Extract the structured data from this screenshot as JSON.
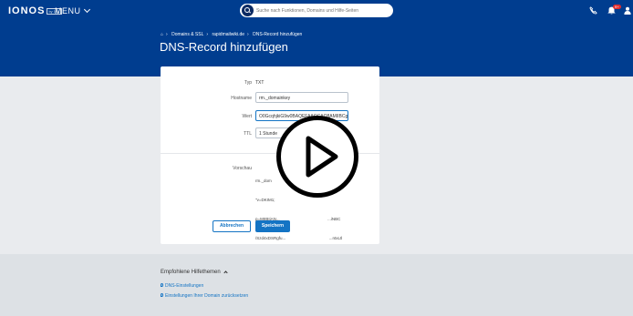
{
  "header": {
    "logo": "IONOS",
    "logo_sub": "by 1&1",
    "menu_label": "MENU",
    "search_placeholder": "Suche nach Funktionen, Domains und Hilfe-Seiten",
    "notification_count": "9+"
  },
  "breadcrumb": {
    "items": [
      "Domains & SSL",
      "rapidmailwiki.de",
      "DNS-Record hinzufügen"
    ]
  },
  "page": {
    "title": "DNS-Record hinzufügen"
  },
  "form": {
    "typ_label": "Typ",
    "typ_value": "TXT",
    "hostname_label": "Hostname",
    "hostname_value": "rm._domainkey",
    "wert_label": "Wert",
    "wert_value": "O0GcqhjkiG9w0BAQEFAAOCAQ8AMIIBCgKCAQEAxDAQAB",
    "ttl_label": "TTL",
    "ttl_value": "1 Stunde",
    "vorschau_label": "Vorschau",
    "vorschau_lines": [
      "rm._dom",
      "\"v=DKIM1;",
      "p=MIIBIjAN...                                          ...iNBC",
      "/Szd4xDSRgfu...                                      ...ntxLtl",
      "/E+FCkDefQyaL7u...",
      "/t3Y9qjFApxkoFnxLMUnexu...(nAObJLWLdSvRUp",
      "/o8WUcKwO8KHOLwIDAQAB\""
    ],
    "cancel_label": "Abbrechen",
    "save_label": "Speichern"
  },
  "help": {
    "title": "Empfohlene Hilfethemen",
    "links": [
      "DNS-Einstellungen",
      "Einstellungen Ihrer Domain zurücksetzen"
    ]
  },
  "colors": {
    "header_blue": "#003d8f",
    "accent": "#1474c4"
  }
}
